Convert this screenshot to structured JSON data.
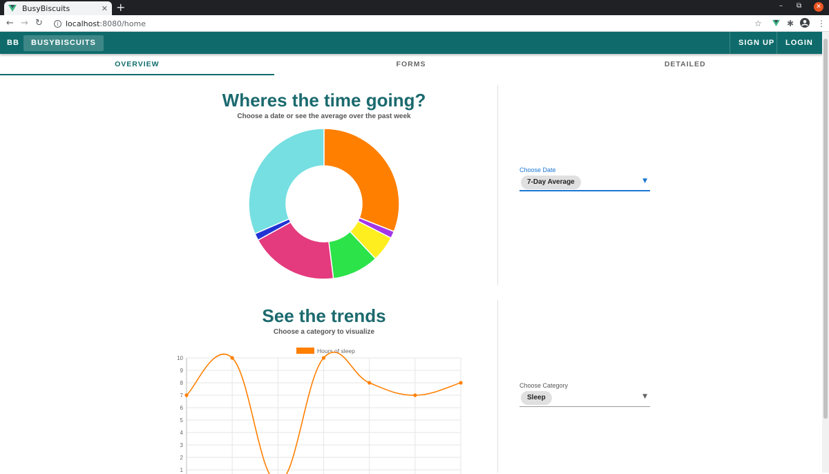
{
  "browser": {
    "tab_title": "BusyBiscuits",
    "tab_close": "✕",
    "new_tab": "+",
    "url_host": "localhost",
    "url_path": ":8080/home",
    "min": "–",
    "max": "⧉",
    "close": "✕"
  },
  "appbar": {
    "brand": "BB",
    "home": "BUSYBISCUITS",
    "signup": "SIGN UP",
    "login": "LOGIN",
    "color": "#0f6b6b"
  },
  "tabs": [
    "OVERVIEW",
    "FORMS",
    "DETAILED"
  ],
  "overview": {
    "title": "Wheres the time going?",
    "subtitle": "Choose a date or see the average over the past week",
    "select_label": "Choose Date",
    "select_value": "7-Day Average"
  },
  "trends": {
    "title": "See the trends",
    "subtitle": "Choose a category to visualize",
    "select_label": "Choose Category",
    "select_value": "Sleep"
  },
  "chart_data": [
    {
      "type": "pie",
      "donut": true,
      "title": "",
      "slices": [
        {
          "value": 31,
          "color": "#ff7f00"
        },
        {
          "value": 1.5,
          "color": "#a236e8"
        },
        {
          "value": 5.5,
          "color": "#ffee1f"
        },
        {
          "value": 10,
          "color": "#2ce34a"
        },
        {
          "value": 19,
          "color": "#e43a7e"
        },
        {
          "value": 1.5,
          "color": "#2233d4"
        },
        {
          "value": 31.5,
          "color": "#75dfe1"
        }
      ]
    },
    {
      "type": "line",
      "series": [
        {
          "name": "Hours of sleep",
          "color": "#ff7f00",
          "values": [
            7,
            10,
            0,
            10,
            8,
            7,
            8
          ]
        }
      ],
      "x_count": 7,
      "ylim": [
        1,
        10
      ],
      "yticks": [
        "10",
        "9",
        "8",
        "7",
        "6",
        "5",
        "4",
        "3",
        "2",
        "1"
      ],
      "grid": true,
      "legend": "top"
    }
  ]
}
